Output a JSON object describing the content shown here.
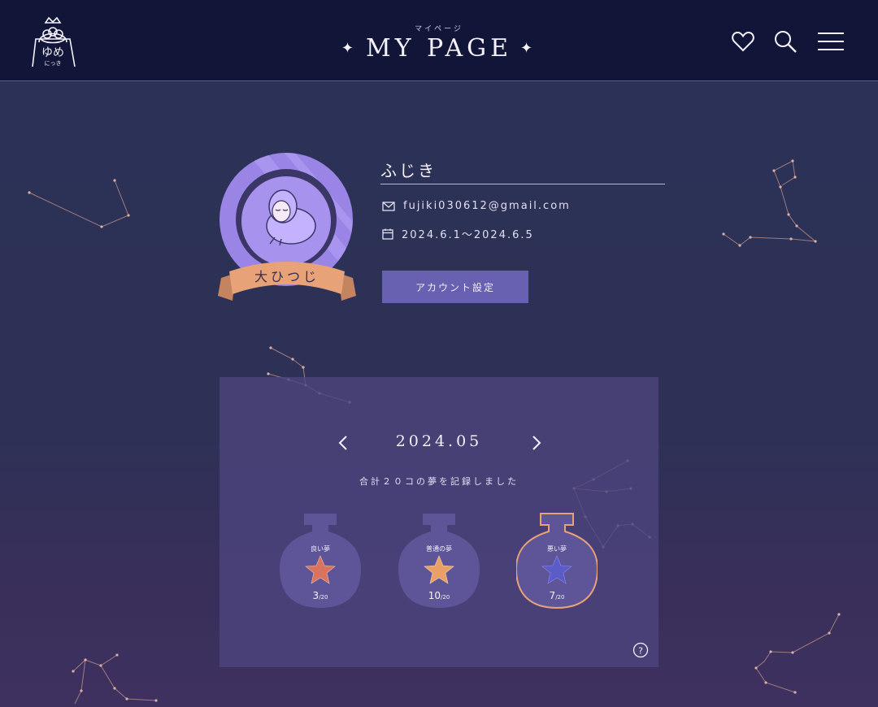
{
  "header": {
    "logo_text_main": "ゆめ",
    "logo_text_sub": "にっき",
    "title_ruby": "マイページ",
    "title": "MY PAGE",
    "spark": "✦",
    "icons": [
      "heart-icon",
      "search-icon",
      "menu-icon"
    ]
  },
  "profile": {
    "badge": "大ひつじ",
    "username": "ふじき",
    "email": "fujiki030612@gmail.com",
    "period": "2024.6.1〜2024.6.5",
    "account_button": "アカウント設定"
  },
  "calendar": {
    "month": "2024.05",
    "prev": "‹",
    "next": "›",
    "total_text": "合計２０コの夢を記録しました"
  },
  "bottles": [
    {
      "label": "良い夢",
      "count": "3",
      "total": "/20",
      "star_color": "#d9735e",
      "selected": false
    },
    {
      "label": "普通の夢",
      "count": "10",
      "total": "/20",
      "star_color": "#e8a066",
      "selected": false
    },
    {
      "label": "悪い夢",
      "count": "7",
      "total": "/20",
      "star_color": "#5b5cc8",
      "selected": true
    }
  ],
  "colors": {
    "header_bg": "#111638",
    "accent": "#6860b0",
    "badge": "#e7a277",
    "constellation": "#c89a8a"
  }
}
